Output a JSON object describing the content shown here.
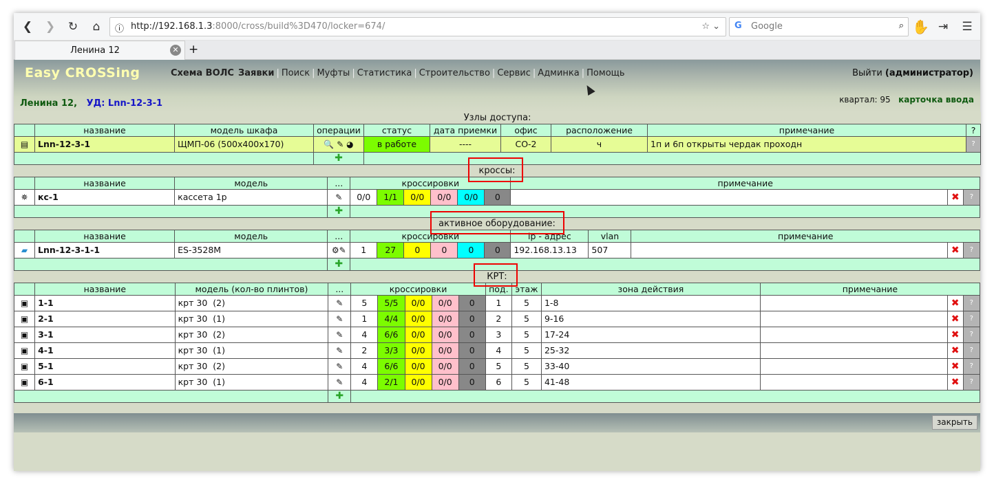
{
  "browser": {
    "url_host": "http://192.168.1.3",
    "url_path": ":8000/cross/build%3D470/locker=674/",
    "search_placeholder": "Google",
    "tab_title": "Ленина 12"
  },
  "app": {
    "logo": "Easy CROSSing",
    "menu": [
      "Схема ВОЛС",
      "Заявки",
      "Поиск",
      "Муфты",
      "Статистика",
      "Строительство",
      "Сервис",
      "Админка",
      "Помощь"
    ],
    "logout": "Выйти",
    "user": "(администратор)",
    "breadcrumb_street": "Ленина 12,",
    "breadcrumb_node": "УД: Lnn-12-3-1",
    "kvartal": "квартал: 95",
    "card_link": "карточка ввода",
    "close_button": "закрыть"
  },
  "nodes": {
    "title": "Узлы доступа:",
    "headers": [
      "название",
      "модель шкафа",
      "операции",
      "статус",
      "дата приемки",
      "офис",
      "расположение",
      "примечание",
      "?"
    ],
    "row": {
      "name": "Lnn-12-3-1",
      "model": "ЩМП-06 (500x400x170)",
      "status": "в работе",
      "date": "----",
      "office": "СО-2",
      "location": "ч",
      "note": "1п и 6п открыты чердак проходн"
    }
  },
  "cross": {
    "title": "кроссы:",
    "headers": [
      "название",
      "модель",
      "...",
      "кроссировки",
      "примечание"
    ],
    "row": {
      "name": "кс-1",
      "model": "кассета 1р",
      "c0": "0/0",
      "c1": "1/1",
      "c2": "0/0",
      "c3": "0/0",
      "c4": "0/0",
      "c5": "0"
    }
  },
  "active": {
    "title": "активное оборудование:",
    "headers": [
      "название",
      "модель",
      "...",
      "кроссировки",
      "ip - адрес",
      "vlan",
      "примечание"
    ],
    "row": {
      "name": "Lnn-12-3-1-1",
      "model": "ES-3528M",
      "c0": "1",
      "c1": "27",
      "c2": "0",
      "c3": "0",
      "c4": "0",
      "c5": "0",
      "ip": "192.168.13.13",
      "vlan": "507"
    }
  },
  "krt": {
    "title": "КРТ:",
    "headers": [
      "название",
      "модель (кол-во плинтов)",
      "...",
      "кроссировки",
      "под.",
      "этаж",
      "зона действия",
      "примечание"
    ],
    "rows": [
      {
        "name": "1-1",
        "model": "крт 30",
        "pl": "(2)",
        "c0": "5",
        "c1": "5/5",
        "c2": "0/0",
        "c3": "0/0",
        "c4": "0",
        "pod": "1",
        "floor": "5",
        "zone": "1-8"
      },
      {
        "name": "2-1",
        "model": "крт 30",
        "pl": "(1)",
        "c0": "1",
        "c1": "4/4",
        "c2": "0/0",
        "c3": "0/0",
        "c4": "0",
        "pod": "2",
        "floor": "5",
        "zone": "9-16"
      },
      {
        "name": "3-1",
        "model": "крт 30",
        "pl": "(2)",
        "c0": "4",
        "c1": "6/6",
        "c2": "0/0",
        "c3": "0/0",
        "c4": "0",
        "pod": "3",
        "floor": "5",
        "zone": "17-24"
      },
      {
        "name": "4-1",
        "model": "крт 30",
        "pl": "(1)",
        "c0": "2",
        "c1": "3/3",
        "c2": "0/0",
        "c3": "0/0",
        "c4": "0",
        "pod": "4",
        "floor": "5",
        "zone": "25-32"
      },
      {
        "name": "5-1",
        "model": "крт 30",
        "pl": "(2)",
        "c0": "4",
        "c1": "6/6",
        "c2": "0/0",
        "c3": "0/0",
        "c4": "0",
        "pod": "5",
        "floor": "5",
        "zone": "33-40"
      },
      {
        "name": "6-1",
        "model": "крт 30",
        "pl": "(1)",
        "c0": "4",
        "c1": "2/1",
        "c2": "0/0",
        "c3": "0/0",
        "c4": "0",
        "pod": "6",
        "floor": "5",
        "zone": "41-48"
      }
    ]
  }
}
